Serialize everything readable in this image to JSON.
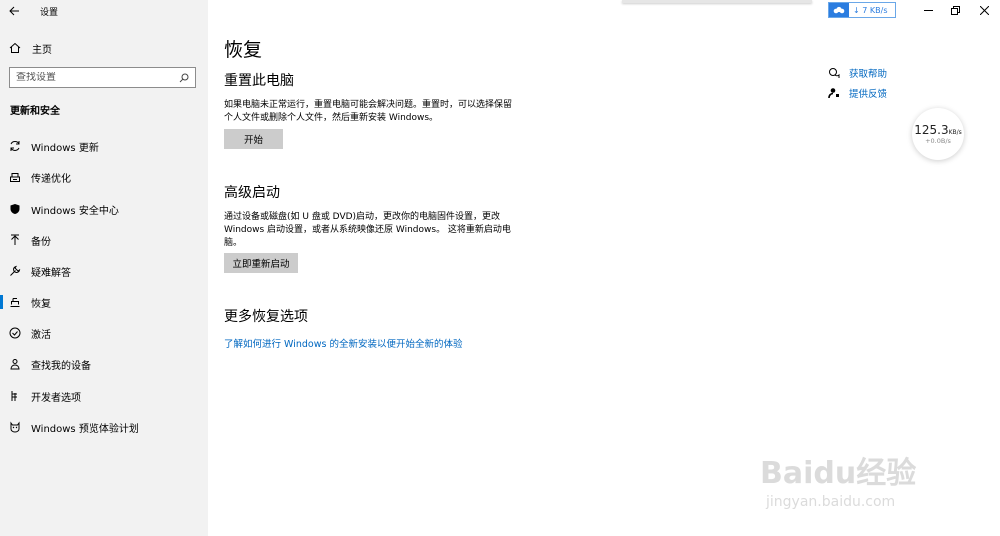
{
  "window": {
    "title": "设置"
  },
  "sidebar": {
    "home_label": "主页",
    "search_placeholder": "查找设置",
    "section_title": "更新和安全",
    "items": [
      {
        "label": "Windows 更新",
        "icon": "refresh-icon"
      },
      {
        "label": "传递优化",
        "icon": "delivery-icon"
      },
      {
        "label": "Windows 安全中心",
        "icon": "shield-icon"
      },
      {
        "label": "备份",
        "icon": "backup-arrow-icon"
      },
      {
        "label": "疑难解答",
        "icon": "wrench-icon"
      },
      {
        "label": "恢复",
        "icon": "recovery-icon",
        "active": true
      },
      {
        "label": "激活",
        "icon": "check-circle-icon"
      },
      {
        "label": "查找我的设备",
        "icon": "person-pin-icon"
      },
      {
        "label": "开发者选项",
        "icon": "developer-icon"
      },
      {
        "label": "Windows 预览体验计划",
        "icon": "insider-cat-icon"
      }
    ]
  },
  "main": {
    "title": "恢复",
    "reset": {
      "heading": "重置此电脑",
      "desc_line1": "如果电脑未正常运行，重置电脑可能会解决问题。重置时，可以选择保留",
      "desc_line2": "个人文件或删除个人文件，然后重新安装 Windows。",
      "button": "开始"
    },
    "advanced": {
      "heading": "高级启动",
      "desc_line1": "通过设备或磁盘(如 U 盘或 DVD)启动，更改你的电脑固件设置，更改",
      "desc_line2": "Windows 启动设置，或者从系统映像还原 Windows。 这将重新启动电",
      "desc_line3": "脑。",
      "button": "立即重新启动"
    },
    "more": {
      "heading": "更多恢复选项",
      "link": "了解如何进行 Windows 的全新安装以便开始全新的体验"
    },
    "help": {
      "get_help": "获取帮助",
      "feedback": "提供反馈"
    }
  },
  "overlay": {
    "net_speed_top": "7 KB/s",
    "speed_value": "125.3",
    "speed_unit": "KB/s",
    "speed_sub": "+0.0B/s"
  },
  "watermark": {
    "main": "Baidu经验",
    "sub": "jingyan.baidu.com"
  },
  "colors": {
    "accent": "#0078d4",
    "link": "#0067c0",
    "sidebar_bg": "#f2f2f2",
    "button_bg": "#cccccc"
  }
}
